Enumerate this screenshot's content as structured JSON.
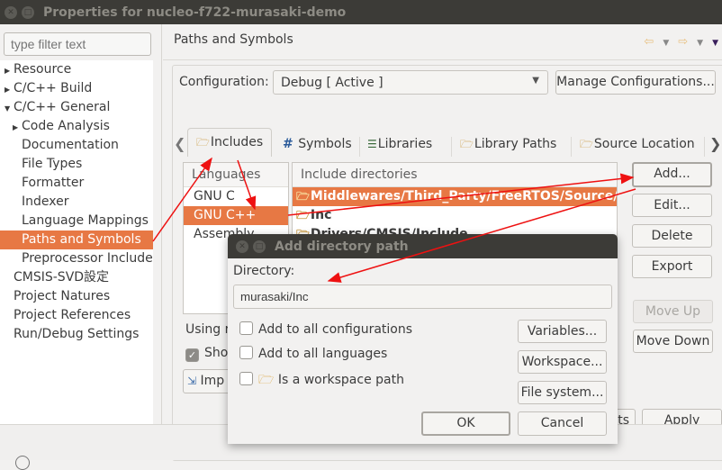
{
  "window": {
    "title": "Properties for nucleo-f722-murasaki-demo"
  },
  "sidebar": {
    "filter_placeholder": "type filter text",
    "items": [
      {
        "label": "Resource",
        "expander": "collapsed",
        "level": 0
      },
      {
        "label": "C/C++ Build",
        "expander": "collapsed",
        "level": 0
      },
      {
        "label": "C/C++ General",
        "expander": "expanded",
        "level": 0
      },
      {
        "label": "Code Analysis",
        "expander": "collapsed",
        "level": 1
      },
      {
        "label": "Documentation",
        "expander": "none",
        "level": 1
      },
      {
        "label": "File Types",
        "expander": "none",
        "level": 1
      },
      {
        "label": "Formatter",
        "expander": "none",
        "level": 1
      },
      {
        "label": "Indexer",
        "expander": "none",
        "level": 1
      },
      {
        "label": "Language Mappings",
        "expander": "none",
        "level": 1
      },
      {
        "label": "Paths and Symbols",
        "expander": "none",
        "level": 1,
        "selected": true
      },
      {
        "label": "Preprocessor Include",
        "expander": "none",
        "level": 1
      },
      {
        "label": "CMSIS-SVD設定",
        "expander": "none",
        "level": 0
      },
      {
        "label": "Project Natures",
        "expander": "none",
        "level": 0
      },
      {
        "label": "Project References",
        "expander": "none",
        "level": 0
      },
      {
        "label": "Run/Debug Settings",
        "expander": "none",
        "level": 0
      }
    ]
  },
  "main": {
    "title": "Paths and Symbols",
    "configuration_label": "Configuration:",
    "configuration_value": "Debug  [ Active ]",
    "manage_button": "Manage Configurations...",
    "tabs": [
      {
        "label": "Includes",
        "icon": "includes-folder-icon",
        "active": true
      },
      {
        "label": "Symbols",
        "icon": "hash-icon"
      },
      {
        "label": "Libraries",
        "icon": "libraries-icon"
      },
      {
        "label": "Library Paths",
        "icon": "library-paths-icon"
      },
      {
        "label": "Source Location",
        "icon": "source-folder-icon"
      }
    ],
    "languages_header": "Languages",
    "languages": [
      "GNU C",
      "GNU C++",
      "Assembly"
    ],
    "selected_language": "GNU C++",
    "includes_header": "Include directories",
    "includes": [
      {
        "path": "Middlewares/Third_Party/FreeRTOS/Source/include",
        "selected": true
      },
      {
        "path": "Inc"
      },
      {
        "path": "Drivers/CMSIS/Include"
      }
    ],
    "side_buttons": {
      "add": "Add...",
      "edit": "Edit...",
      "delete": "Delete",
      "export": "Export",
      "move_up": "Move Up",
      "move_down": "Move Down"
    },
    "using_text": "Using r",
    "show_label": "Show",
    "show_checked": true,
    "import_label": "Imp",
    "restore_label": "ts",
    "apply": "Apply"
  },
  "dialog": {
    "title": "Add directory path",
    "directory_label": "Directory:",
    "directory_value": "murasaki/Inc",
    "checks": [
      {
        "label": "Add to all configurations",
        "checked": false
      },
      {
        "label": "Add to all languages",
        "checked": false
      },
      {
        "label": "Is a workspace path",
        "checked": false,
        "icon": "folder-icon"
      }
    ],
    "variables": "Variables...",
    "workspace": "Workspace...",
    "file_system": "File system...",
    "ok": "OK",
    "cancel": "Cancel"
  },
  "annotation": {
    "arrow_color": "#ee1111"
  }
}
